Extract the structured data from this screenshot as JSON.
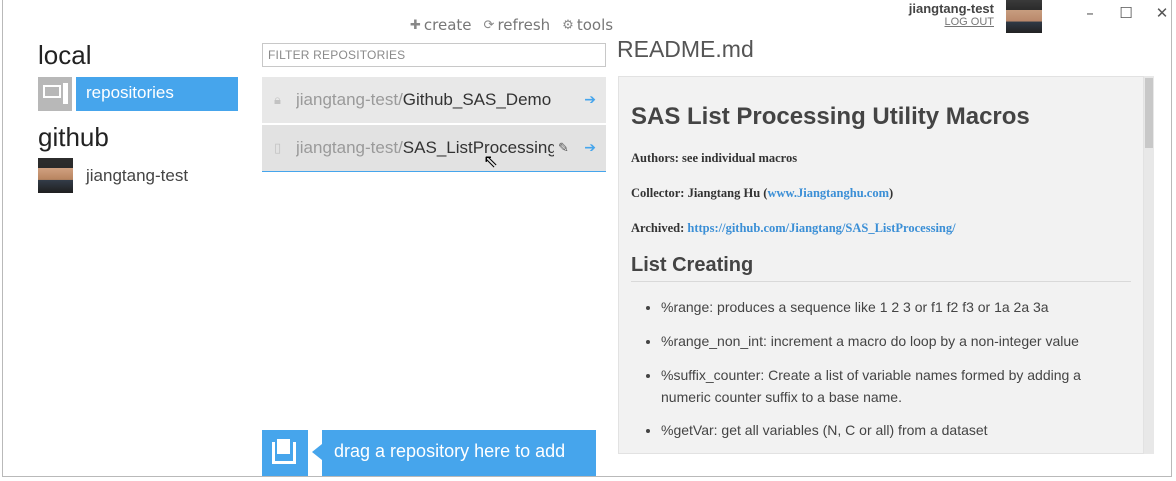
{
  "toolbar": {
    "create_label": "create",
    "refresh_label": "refresh",
    "tools_label": "tools"
  },
  "account": {
    "username": "jiangtang-test",
    "logout_label": "LOG OUT"
  },
  "window_controls": {
    "minimize": "–",
    "maximize": "☐",
    "close": "✕"
  },
  "sidebar": {
    "local_heading": "local",
    "local_item_label": "repositories",
    "github_heading": "github",
    "github_user_label": "jiangtang-test"
  },
  "repositories": {
    "filter_placeholder": "FILTER REPOSITORIES",
    "items": [
      {
        "owner": "jiangtang-test/",
        "name": "Github_SAS_Demo",
        "kind_icon": "lock-icon"
      },
      {
        "owner": "jiangtang-test/",
        "name": "SAS_ListProcessing",
        "kind_icon": "book-icon"
      }
    ],
    "dropzone_label": "drag a repository here to add"
  },
  "readme": {
    "file_title": "README.md",
    "heading": "SAS List Processing Utility Macros",
    "authors_text": "Authors: see individual macros",
    "collector_prefix": "Collector: Jiangtang Hu (",
    "collector_link": "www.Jiangtanghu.com",
    "collector_suffix": ")",
    "archived_prefix": "Archived: ",
    "archived_link": "https://github.com/Jiangtang/SAS_ListProcessing/",
    "section_heading": "List Creating",
    "list": [
      "%range: produces a sequence like 1 2 3 or f1 f2 f3 or 1a 2a 3a",
      "%range_non_int: increment a macro do loop by a non-integer value",
      "%suffix_counter: Create a list of variable names formed by adding a numeric counter suffix to a base name.",
      "%getVar: get all variables (N, C or all) from a dataset"
    ]
  },
  "colors": {
    "accent": "#46a5ec",
    "link": "#3b8fd6"
  }
}
